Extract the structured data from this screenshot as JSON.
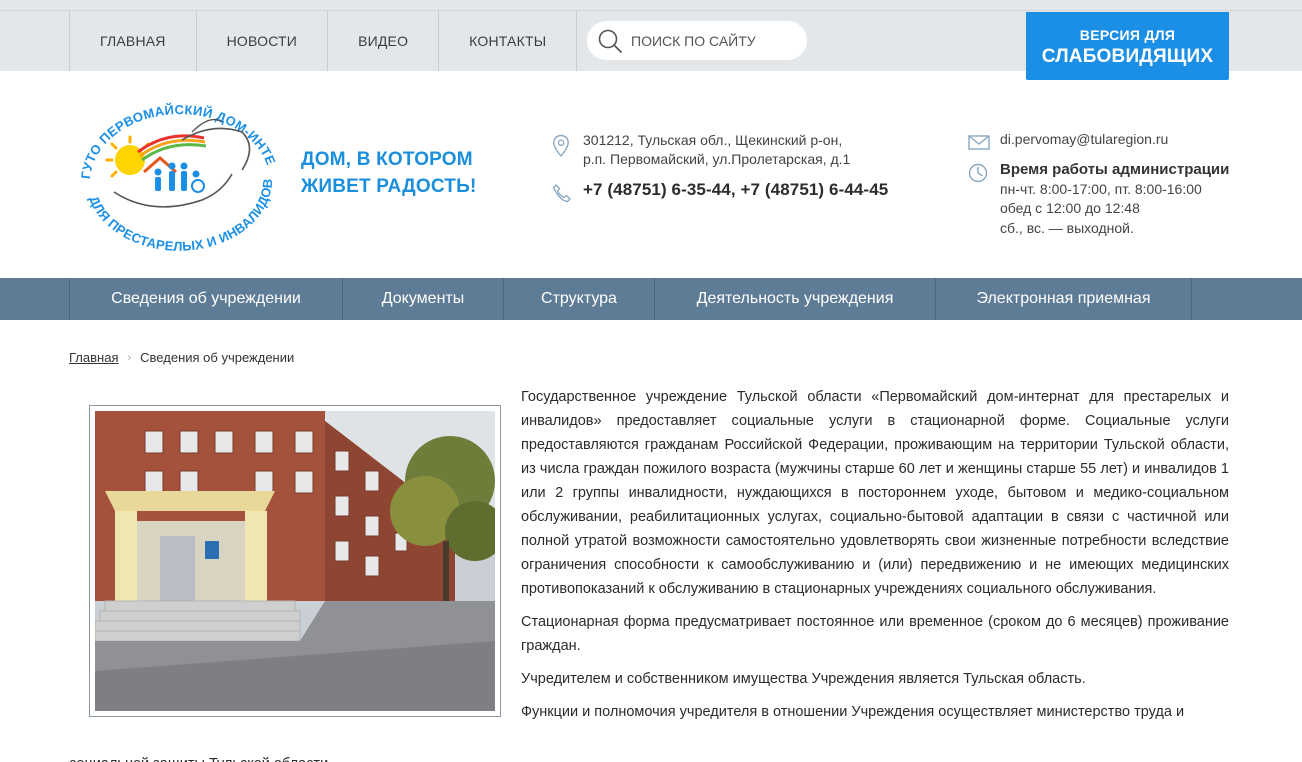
{
  "topnav": {
    "items": [
      "ГЛАВНАЯ",
      "НОВОСТИ",
      "ВИДЕО",
      "КОНТАКТЫ"
    ],
    "search_placeholder": "ПОИСК ПО САЙТУ",
    "vision_line1": "ВЕРСИЯ ДЛЯ",
    "vision_line2": "СЛАБОВИДЯЩИХ"
  },
  "header": {
    "logo_text_top": "ГУТО ПЕРВОМАЙСКИЙ ДОМ-ИНТЕРНАТ",
    "logo_text_bottom": "ДЛЯ ПРЕСТАРЕЛЫХ И ИНВАЛИДОВ",
    "slogan_line1": "ДОМ, В КОТОРОМ",
    "slogan_line2": "ЖИВЕТ РАДОСТЬ!",
    "address_line1": "301212, Тульская обл., Щекинский р-он,",
    "address_line2": "р.п. Первомайский, ул.Пролетарская, д.1",
    "phone1": "+7 (48751) 6-35-44",
    "phone_sep": ", ",
    "phone2": "+7 (48751) 6-44-45",
    "email": "di.pervomay@tularegion.ru",
    "hours_title": "Время работы администрации",
    "hours_line1": "пн-чт. 8:00-17:00, пт. 8:00-16:00",
    "hours_line2": "обед с 12:00 до 12:48",
    "hours_line3": "сб., вс. — выходной."
  },
  "mainnav": {
    "items": [
      "Сведения об учреждении",
      "Документы",
      "Структура",
      "Деятельность учреждения",
      "Электронная приемная"
    ]
  },
  "breadcrumb": {
    "home": "Главная",
    "separator": "›",
    "current": "Сведения об учреждении"
  },
  "article": {
    "paragraphs": [
      "Государственное учреждение Тульской области «Первомайский дом-интернат для престарелых и инвалидов» предоставляет социальные услуги в стационарной форме. Социальные услуги предоставляются гражданам Российской Федерации, проживающим на территории Тульской области, из числа граждан пожилого возраста (мужчины старше 60 лет и женщины старше 55 лет) и инвалидов 1 или 2 группы инвалидности, нуждающихся в постороннем уходе, бытовом и медико-социальном обслуживании, реабилитационных услугах, социально-бытовой адаптации в связи с частичной или полной утратой возможности самостоятельно удовлетворять свои жизненные потребности вследствие ограничения способности к самообслуживанию и (или) передвижению и не имеющих медицинских противопоказаний к обслуживанию в стационарных учреждениях социального обслуживания.",
      "Стационарная форма предусматривает постоянное или временное (сроком до 6 месяцев) проживание граждан.",
      "Учредителем и собственником имущества Учреждения является Тульская область.",
      "Функции и полномочия учредителя в отношении Учреждения осуществляет министерство труда и"
    ],
    "tail": "социальной защиты Тульской области."
  },
  "colors": {
    "accent": "#1b8fe6",
    "nav_bg": "#5e7c96",
    "topbar_bg": "#e4e7ea",
    "slogan": "#1c8fdc"
  },
  "icons": [
    "search-icon",
    "location-pin-icon",
    "phone-icon",
    "mail-icon",
    "clock-icon"
  ]
}
